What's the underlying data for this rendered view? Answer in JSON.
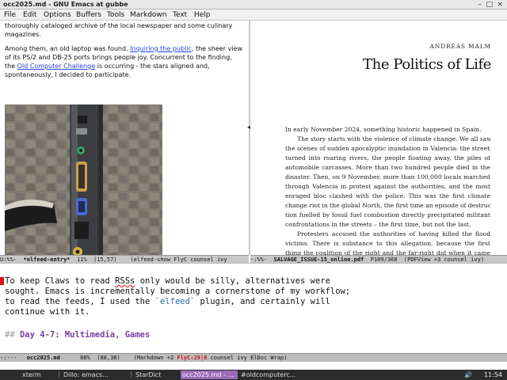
{
  "window": {
    "title": "occ2025.md - GNU Emacs at gubbe"
  },
  "menu": [
    "File",
    "Edit",
    "Options",
    "Buffers",
    "Tools",
    "Markdown",
    "Text",
    "Help"
  ],
  "elfeed": {
    "p1": "thoroughly cataloged archive of the local newspaper and some culinary magazines.",
    "p2_a": "Among them, an old laptop was found. ",
    "p2_link1": "Inquiring the public",
    "p2_b": ", the sheer view of its PS/2 and DB-25 ports brings people joy. Concurrent to the finding, the ",
    "p2_link2": "Old Computer Challenge",
    "p2_c": " is occurring - the stars aligned and, spontaneously, I decided to participate."
  },
  "pdf": {
    "author": "ANDREAS MALM",
    "title": "The Politics of Life",
    "lines": [
      "In early November 2024, something historic happened in Spain.",
      "The story starts with the violence of climate change. We all saw",
      "the scenes of sudden apocalyptic inundation in Valencia: the streets",
      "turned into roaring rivers, the people floating away, the piles of",
      "automobile carcasses. More than two hundred people died in the",
      "disaster. Then, on 9 November, more than 100,000 locals marched",
      "through Valencia in protest against the authorities, and the most",
      "enraged bloc clashed with the police. This was the first climate",
      "change riot in the global North, the first time an episode of destruc-",
      "tion fuelled by fossil fuel combustion directly precipitated militant",
      "confrontations in the streets – the first time, but not the last.",
      "Protesters accused the authorities of having killed the flood",
      "victims. There is substance to this allegation, because the first",
      "thing the coalition of the right and the far-right did when it came"
    ]
  },
  "modeline_left": {
    "prefix": "U:%%-  ",
    "buffer": "*elfeed-entry*",
    "rest": "  11%  (15,57)    (elfeed-show FlyC counsel ivy"
  },
  "modeline_right": {
    "prefix": "-:%%-  ",
    "buffer": "SALVAGE_ISSUE-15_online.pdf",
    "rest": "  P109/368  (PDFView +3 counsel ivy)"
  },
  "markdown": {
    "l1_a": "To keep Claws to read ",
    "l1_spell": "RSSs",
    "l1_b": " only would be silly, alternatives were",
    "l2": "sought. Emacs is incrementally becoming a cornerstone of my workflow;",
    "l3_a": "to read the feeds, I used the ",
    "l3_code": "`elfeed`",
    "l3_b": " plugin, and certainly will",
    "l4": "continue with it.",
    "heading_marks": "## ",
    "heading": "Day 4-7: Multimedia, Games"
  },
  "modeline_bottom": {
    "prefix": "-:---   ",
    "buffer": "occ2025.md",
    "pos": "      88%  (88,38)    (Markdown +2 ",
    "flyc": "FlyC:29|0",
    "rest": " counsel ivy ElDoc Wrap)"
  },
  "taskbar": {
    "items": [
      "xterm",
      "Dillo: emacs...",
      "StarDict",
      "occ2025.md - ...",
      "#oldcomputerc..."
    ],
    "active_index": 3,
    "clock": "11:54",
    "tray_symbol": "🔊"
  },
  "colors": {
    "link": "#2244dd",
    "active_task": "#9b6ab8",
    "error": "#cc1111"
  }
}
